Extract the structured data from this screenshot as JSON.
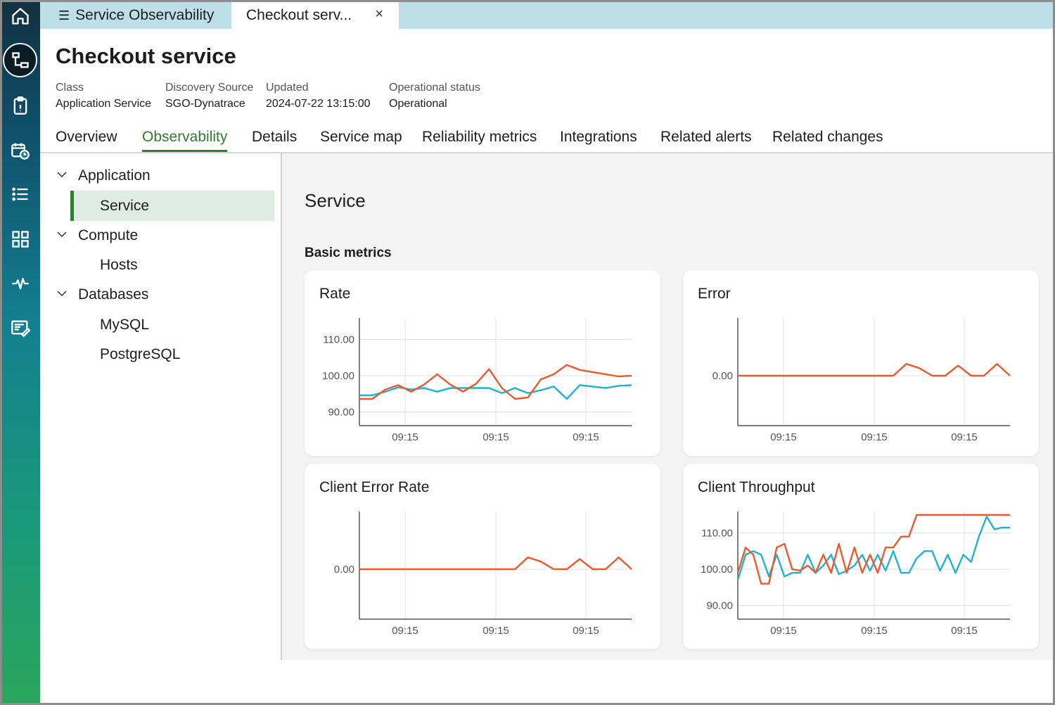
{
  "rail": {
    "items": [
      {
        "icon": "home-icon"
      },
      {
        "icon": "service-tree-icon",
        "active": true
      },
      {
        "icon": "clipboard-icon"
      },
      {
        "icon": "calendar-clock-icon"
      },
      {
        "icon": "list-icon"
      },
      {
        "icon": "dashboard-grid-icon"
      },
      {
        "icon": "pulse-icon"
      },
      {
        "icon": "report-edit-icon"
      }
    ]
  },
  "tabs": {
    "first_label": "Service Observability",
    "second_label": "Checkout serv...",
    "close_glyph": "×"
  },
  "header": {
    "title": "Checkout service",
    "meta": [
      {
        "key": "Class",
        "value": "Application Service"
      },
      {
        "key": "Discovery Source",
        "value": "SGO-Dynatrace"
      },
      {
        "key": "Updated",
        "value": "2024-07-22 13:15:00"
      },
      {
        "key": "Operational status",
        "value": "Operational"
      }
    ]
  },
  "nav": {
    "tabs": [
      "Overview",
      "Observability",
      "Details",
      "Service map",
      "Reliability metrics",
      "Integrations",
      "Related alerts",
      "Related changes"
    ],
    "active": "Observability"
  },
  "tree": {
    "application": "Application",
    "service": "Service",
    "compute": "Compute",
    "hosts": "Hosts",
    "databases": "Databases",
    "mysql": "MySQL",
    "postgresql": "PostgreSQL"
  },
  "content": {
    "section_title": "Service",
    "subsection_title": "Basic metrics"
  },
  "colors": {
    "orange": "#ea5a2f",
    "blue": "#1fb3d1",
    "accent_green": "#2e7d32"
  },
  "chart_data": [
    {
      "type": "line",
      "title": "Rate",
      "x_ticks": [
        "09:15",
        "09:15",
        "09:15"
      ],
      "y_ticks": [
        "110.00",
        "100.00",
        "90.00"
      ],
      "ylim": [
        84,
        115
      ],
      "series": [
        {
          "color": "#ea5a2f",
          "values": [
            93.6,
            93.6,
            96.2,
            97.4,
            95.6,
            97.6,
            100.4,
            97.6,
            95.6,
            97.8,
            101.8,
            96.6,
            93.6,
            94.0,
            99.0,
            100.4,
            103.0,
            101.6,
            101.0,
            100.4,
            99.8,
            100.0
          ]
        },
        {
          "color": "#1fb3d1",
          "values": [
            94.6,
            94.6,
            95.6,
            96.8,
            96.2,
            96.6,
            95.6,
            96.6,
            96.6,
            96.6,
            96.6,
            95.2,
            96.6,
            95.2,
            96.0,
            97.0,
            93.6,
            97.4,
            97.0,
            96.6,
            97.2,
            97.4
          ]
        }
      ]
    },
    {
      "type": "line",
      "title": "Error",
      "x_ticks": [
        "09:15",
        "09:15",
        "09:15"
      ],
      "y_ticks": [
        "0.00"
      ],
      "series": [
        {
          "color": "#ea5a2f",
          "values": [
            0,
            0,
            0,
            0,
            0,
            0,
            0,
            0,
            0,
            0,
            0,
            0,
            0,
            0.28,
            0.18,
            0,
            0,
            0.24,
            0,
            0,
            0.28,
            0
          ]
        }
      ]
    },
    {
      "type": "line",
      "title": "Client Error Rate",
      "x_ticks": [
        "09:15",
        "09:15",
        "09:15"
      ],
      "y_ticks": [
        "0.00"
      ],
      "series": [
        {
          "color": "#ea5a2f",
          "values": [
            0,
            0,
            0,
            0,
            0,
            0,
            0,
            0,
            0,
            0,
            0,
            0,
            0,
            0.28,
            0.18,
            0,
            0,
            0.24,
            0,
            0,
            0.28,
            0
          ]
        }
      ]
    },
    {
      "type": "line",
      "title": "Client Throughput",
      "x_ticks": [
        "09:15",
        "09:15",
        "09:15"
      ],
      "y_ticks": [
        "110.00",
        "100.00",
        "90.00"
      ],
      "ylim": [
        84,
        115
      ],
      "series": [
        {
          "color": "#ea5a2f",
          "values": [
            99,
            106,
            104,
            96,
            96,
            106,
            107,
            100,
            99.6,
            101,
            99,
            104,
            99,
            107,
            99,
            106,
            99,
            104,
            99,
            106,
            106,
            109,
            109,
            115,
            115,
            115,
            115,
            115,
            115,
            115,
            115,
            115,
            115,
            115,
            115,
            115
          ]
        },
        {
          "color": "#1fb3d1",
          "values": [
            97,
            104,
            105,
            104,
            98,
            104,
            98,
            99,
            99,
            104,
            99,
            101,
            104,
            98.6,
            99.6,
            101,
            104,
            99.6,
            104,
            99.6,
            105,
            99,
            99,
            103,
            105,
            105,
            99.6,
            104,
            99,
            104,
            102,
            109,
            114.5,
            111,
            111.5,
            111.5
          ]
        }
      ]
    }
  ]
}
